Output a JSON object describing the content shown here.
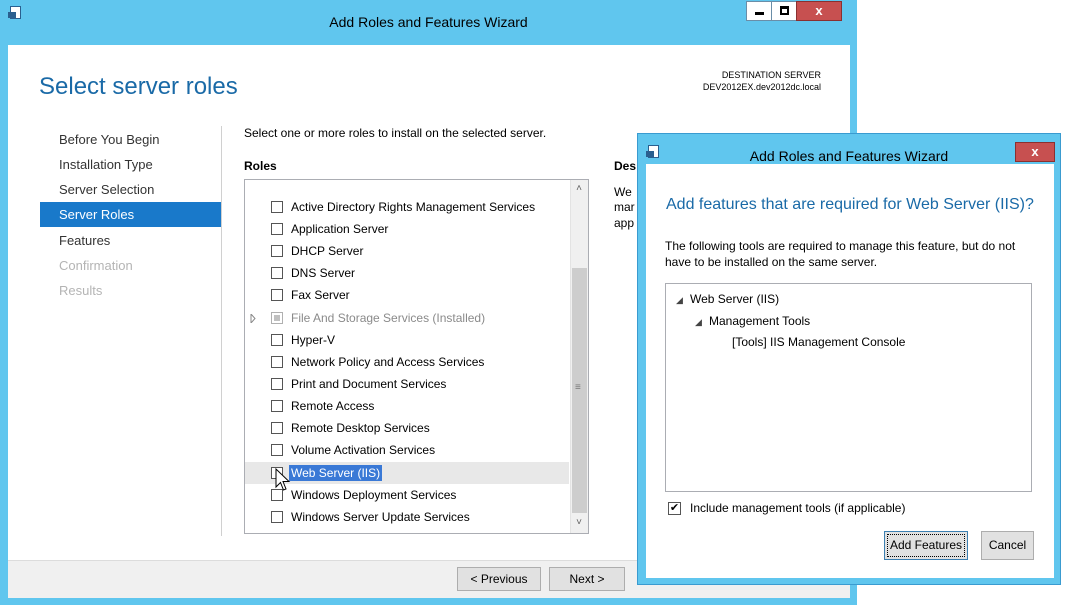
{
  "main_window": {
    "title": "Add Roles and Features Wizard",
    "controls": {
      "minimize": "‒",
      "maximize": "□",
      "close": "x"
    }
  },
  "page": {
    "heading": "Select server roles",
    "destination_label": "DESTINATION SERVER",
    "destination_value": "DEV2012EX.dev2012dc.local",
    "instruction": "Select one or more roles to install on the selected server.",
    "roles_header": "Roles",
    "description_header": "Des",
    "description_fragments": [
      "We",
      "mar",
      "app"
    ]
  },
  "nav": {
    "items": [
      {
        "label": "Before You Begin",
        "state": "normal"
      },
      {
        "label": "Installation Type",
        "state": "normal"
      },
      {
        "label": "Server Selection",
        "state": "normal"
      },
      {
        "label": "Server Roles",
        "state": "active"
      },
      {
        "label": "Features",
        "state": "normal"
      },
      {
        "label": "Confirmation",
        "state": "disabled"
      },
      {
        "label": "Results",
        "state": "disabled"
      }
    ]
  },
  "roles": [
    {
      "label": "Active Directory Rights Management Services"
    },
    {
      "label": "Application Server"
    },
    {
      "label": "DHCP Server"
    },
    {
      "label": "DNS Server"
    },
    {
      "label": "Fax Server"
    },
    {
      "label": "File And Storage Services (Installed)"
    },
    {
      "label": "Hyper-V"
    },
    {
      "label": "Network Policy and Access Services"
    },
    {
      "label": "Print and Document Services"
    },
    {
      "label": "Remote Access"
    },
    {
      "label": "Remote Desktop Services"
    },
    {
      "label": "Volume Activation Services"
    },
    {
      "label": "Web Server (IIS)"
    },
    {
      "label": "Windows Deployment Services"
    },
    {
      "label": "Windows Server Update Services"
    }
  ],
  "scrollbar": {
    "up": "˄",
    "down": "˅",
    "grip": "≡"
  },
  "footer": {
    "previous": "< Previous",
    "next": "Next >"
  },
  "dialog": {
    "title": "Add Roles and Features Wizard",
    "close": "x",
    "heading": "Add features that are required for Web Server (IIS)?",
    "body_line1": "The following tools are required to manage this feature, but do not",
    "body_line2": "have to be installed on the same server.",
    "tree": [
      {
        "label": "Web Server (IIS)",
        "expander": "◢"
      },
      {
        "label": "Management Tools",
        "expander": "◢"
      },
      {
        "label": "[Tools] IIS Management Console",
        "expander": ""
      }
    ],
    "include_tools_label": "Include management tools (if applicable)",
    "include_tools_checked": "✔",
    "add_features": "Add Features",
    "cancel": "Cancel"
  }
}
